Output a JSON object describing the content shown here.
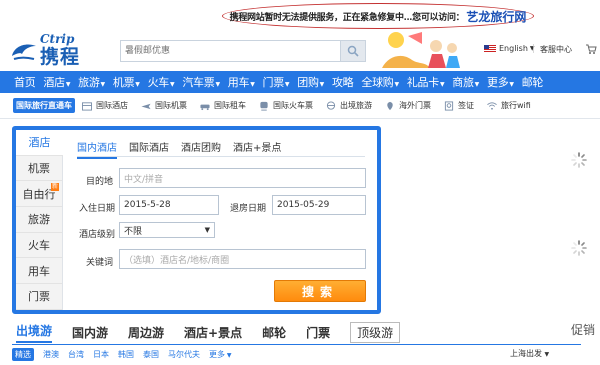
{
  "notice": {
    "text": "携程网站暂时无法提供服务，正在紧急修复中...您可以访问：",
    "link": "艺龙旅行网"
  },
  "header": {
    "logo_word": "Ctrip",
    "logo_cn": "携程",
    "search_placeholder": "暑假邮优惠",
    "language": "English",
    "service": "客服中心"
  },
  "nav": [
    {
      "label": "首页",
      "dropdown": false
    },
    {
      "label": "酒店",
      "dropdown": true
    },
    {
      "label": "旅游",
      "dropdown": true
    },
    {
      "label": "机票",
      "dropdown": true
    },
    {
      "label": "火车",
      "dropdown": true
    },
    {
      "label": "汽车票",
      "dropdown": true
    },
    {
      "label": "用车",
      "dropdown": true
    },
    {
      "label": "门票",
      "dropdown": true
    },
    {
      "label": "团购",
      "dropdown": true
    },
    {
      "label": "攻略",
      "dropdown": false
    },
    {
      "label": "全球购",
      "dropdown": true
    },
    {
      "label": "礼品卡",
      "dropdown": true
    },
    {
      "label": "商旅",
      "dropdown": true
    },
    {
      "label": "更多",
      "dropdown": true
    },
    {
      "label": "邮轮",
      "dropdown": false
    }
  ],
  "subnav": {
    "tag": "国际旅行直通车",
    "items": [
      {
        "label": "国际酒店",
        "icon": "hotel-icon"
      },
      {
        "label": "国际机票",
        "icon": "plane-icon"
      },
      {
        "label": "国际租车",
        "icon": "car-icon"
      },
      {
        "label": "国际火车票",
        "icon": "train-icon"
      },
      {
        "label": "出境旅游",
        "icon": "tour-icon"
      },
      {
        "label": "海外门票",
        "icon": "location-pin-icon"
      },
      {
        "label": "签证",
        "icon": "visa-icon"
      },
      {
        "label": "旅行wifi",
        "icon": "wifi-icon"
      }
    ]
  },
  "panel": {
    "side": [
      {
        "label": "酒店",
        "active": true
      },
      {
        "label": "机票",
        "active": false
      },
      {
        "label": "自由行",
        "active": false,
        "badge": "新"
      },
      {
        "label": "旅游",
        "active": false
      },
      {
        "label": "火车",
        "active": false
      },
      {
        "label": "用车",
        "active": false
      },
      {
        "label": "门票",
        "active": false
      }
    ],
    "tabs": [
      "国内酒店",
      "国际酒店",
      "酒店团购",
      "酒店+景点"
    ],
    "destination_label": "目的地",
    "destination_placeholder": "中文/拼音",
    "checkin_label": "入住日期",
    "checkin_value": "2015-5-28",
    "checkout_label": "退房日期",
    "checkout_value": "2015-05-29",
    "level_label": "酒店级别",
    "level_value": "不限",
    "keyword_label": "关键词",
    "keyword_placeholder": "（选填）酒店名/地标/商圈",
    "search_button": "搜索"
  },
  "bottom": {
    "tabs": [
      "出境游",
      "国内游",
      "周边游",
      "酒店+景点",
      "邮轮",
      "门票",
      "顶级游"
    ],
    "promo": "促销",
    "regions": [
      "精选",
      "港澳",
      "台湾",
      "日本",
      "韩国",
      "泰国",
      "马尔代夫",
      "更多"
    ],
    "depart": "上海出发"
  },
  "colors": {
    "brand_blue": "#2577e3",
    "orange": "#ff8b0d",
    "notice_red": "#c43232"
  }
}
